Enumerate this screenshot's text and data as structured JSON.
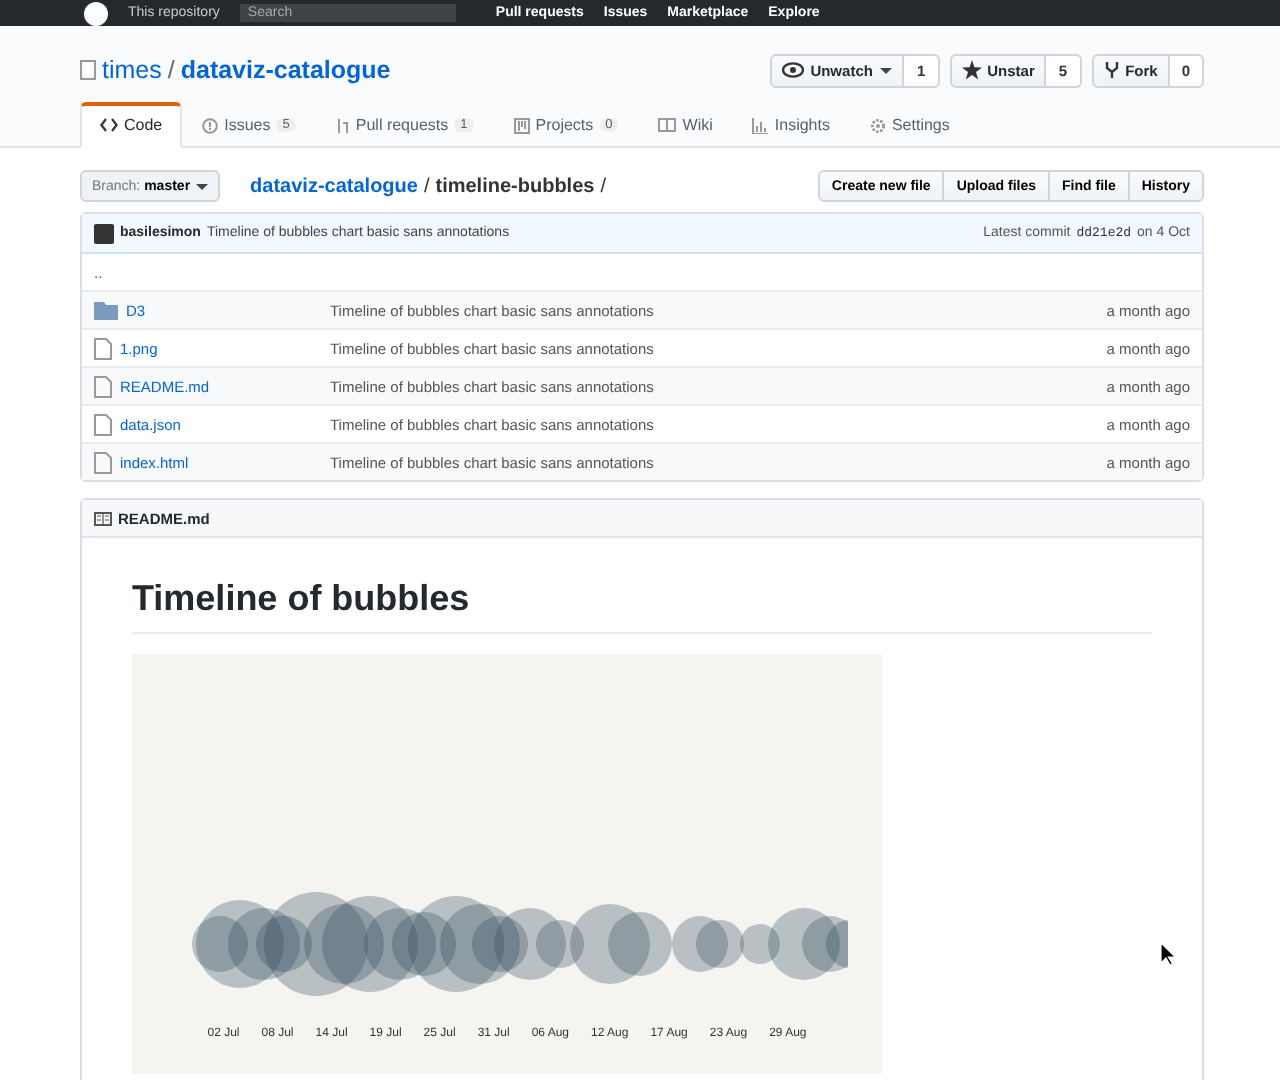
{
  "navbar": {
    "scope": "This repository",
    "search_placeholder": "Search",
    "links": [
      "Pull requests",
      "Issues",
      "Marketplace",
      "Explore"
    ]
  },
  "repo": {
    "owner": "times",
    "separator": "/",
    "name": "dataviz-catalogue"
  },
  "actions": [
    {
      "label": "Unwatch",
      "count": "1",
      "kind": "watch"
    },
    {
      "label": "Unstar",
      "count": "5",
      "kind": "star"
    },
    {
      "label": "Fork",
      "count": "0",
      "kind": "fork"
    }
  ],
  "tabs": [
    {
      "label": "Code",
      "selected": true,
      "kind": "code"
    },
    {
      "label": "Issues",
      "count": "5",
      "selected": false,
      "kind": "issues"
    },
    {
      "label": "Pull requests",
      "count": "1",
      "selected": false,
      "kind": "pr"
    },
    {
      "label": "Projects",
      "count": "0",
      "selected": false,
      "kind": "projects"
    },
    {
      "label": "Wiki",
      "selected": false,
      "kind": "wiki"
    },
    {
      "label": "Insights",
      "selected": false,
      "kind": "insights"
    },
    {
      "label": "Settings",
      "selected": false,
      "kind": "settings"
    }
  ],
  "branch": {
    "label": "Branch:",
    "value": "master"
  },
  "breadcrumb": {
    "repo": "dataviz-catalogue",
    "path": "timeline-bubbles",
    "separator": "/"
  },
  "file_buttons": [
    "Create new file",
    "Upload files",
    "Find file",
    "History"
  ],
  "commit": {
    "author": "basilesimon",
    "message": "Timeline of bubbles chart basic sans annotations",
    "prefix": "Latest commit",
    "sha": "dd21e2d",
    "date": "on 4 Oct"
  },
  "files": [
    {
      "name": "..",
      "kind": "up"
    },
    {
      "name": "D3",
      "kind": "dir",
      "message": "Timeline of bubbles chart basic sans annotations",
      "age": "a month ago"
    },
    {
      "name": "1.png",
      "kind": "file",
      "message": "Timeline of bubbles chart basic sans annotations",
      "age": "a month ago"
    },
    {
      "name": "README.md",
      "kind": "file",
      "message": "Timeline of bubbles chart basic sans annotations",
      "age": "a month ago"
    },
    {
      "name": "data.json",
      "kind": "file",
      "message": "Timeline of bubbles chart basic sans annotations",
      "age": "a month ago"
    },
    {
      "name": "index.html",
      "kind": "file",
      "message": "Timeline of bubbles chart basic sans annotations",
      "age": "a month ago"
    }
  ],
  "readme": {
    "filename": "README.md",
    "heading": "Timeline of bubbles",
    "chart_axis_labels": [
      "02 Jul",
      "08 Jul",
      "14 Jul",
      "19 Jul",
      "25 Jul",
      "31 Jul",
      "06 Aug",
      "12 Aug",
      "17 Aug",
      "23 Aug",
      "29 Aug"
    ]
  }
}
